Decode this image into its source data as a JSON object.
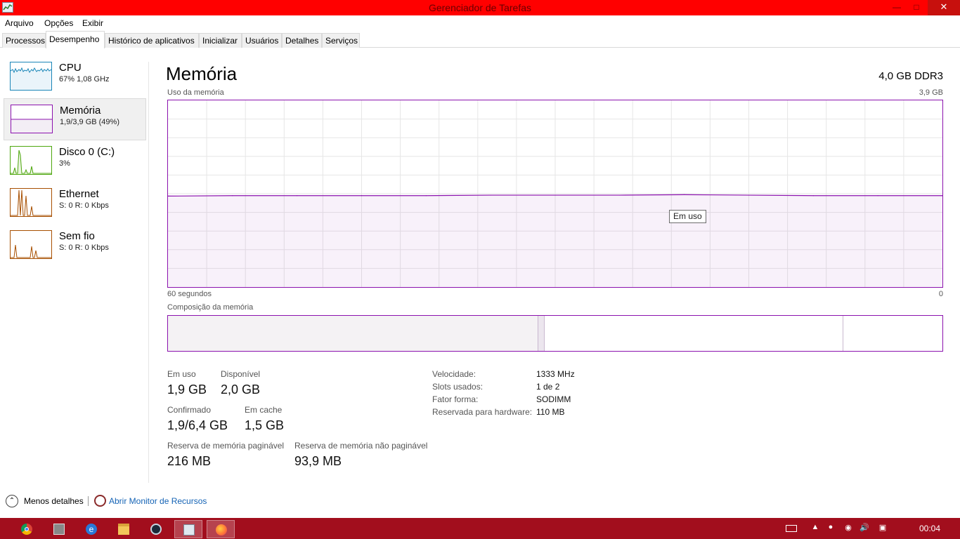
{
  "window": {
    "title": "Gerenciador de Tarefas",
    "controls": {
      "minimize": "—",
      "maximize": "□",
      "close": "✕"
    }
  },
  "menu": [
    "Arquivo",
    "Opções",
    "Exibir"
  ],
  "tabs": [
    "Processos",
    "Desempenho",
    "Histórico de aplicativos",
    "Inicializar",
    "Usuários",
    "Detalhes",
    "Serviços"
  ],
  "active_tab": "Desempenho",
  "sidebar": {
    "items": [
      {
        "name": "CPU",
        "detail": "67% 1,08 GHz",
        "color": "#1a86b8"
      },
      {
        "name": "Memória",
        "detail": "1,9/3,9 GB (49%)",
        "color": "#8b12ae",
        "selected": true
      },
      {
        "name": "Disco 0 (C:)",
        "detail": "3%",
        "color": "#4da60c"
      },
      {
        "name": "Ethernet",
        "detail": "S: 0 R: 0 Kbps",
        "color": "#a74f01"
      },
      {
        "name": "Sem fio",
        "detail": "S: 0 R: 0 Kbps",
        "color": "#a74f01"
      }
    ]
  },
  "main": {
    "title": "Memória",
    "spec": "4,0 GB DDR3",
    "usage_caption": "Uso da memória",
    "usage_max": "3,9 GB",
    "time_left": "60 segundos",
    "time_right": "0",
    "tooltip": "Em uso",
    "composition_caption": "Composição da memória",
    "stats": {
      "in_use_label": "Em uso",
      "in_use_value": "1,9 GB",
      "available_label": "Disponível",
      "available_value": "2,0 GB",
      "committed_label": "Confirmado",
      "committed_value": "1,9/6,4 GB",
      "cached_label": "Em cache",
      "cached_value": "1,5 GB",
      "paged_label": "Reserva de memória paginável",
      "paged_value": "216 MB",
      "nonpaged_label": "Reserva de memória não paginável",
      "nonpaged_value": "93,9 MB"
    },
    "info": {
      "speed_label": "Velocidade:",
      "speed_value": "1333 MHz",
      "slots_label": "Slots usados:",
      "slots_value": "1 de 2",
      "form_label": "Fator forma:",
      "form_value": "SODIMM",
      "reserved_label": "Reservada para hardware:",
      "reserved_value": "110 MB"
    }
  },
  "footer": {
    "less_details": "Menos detalhes",
    "resource_monitor": "Abrir Monitor de Recursos"
  },
  "taskbar": {
    "apps": [
      "chrome-icon",
      "calculator-icon",
      "internet-explorer-icon",
      "file-explorer-icon",
      "steam-icon",
      "task-manager-icon",
      "firefox-icon"
    ],
    "time": "00:04"
  },
  "chart_data": {
    "type": "area",
    "title": "Uso da memória",
    "xlabel": "",
    "ylabel": "",
    "x": [
      60,
      55,
      50,
      45,
      40,
      35,
      30,
      25,
      20,
      15,
      10,
      5,
      0
    ],
    "series": [
      {
        "values": [
          1.9,
          1.91,
          1.91,
          1.91,
          1.91,
          1.92,
          1.92,
          1.92,
          1.93,
          1.92,
          1.91,
          1.91,
          1.91
        ]
      }
    ],
    "ylim": [
      0,
      3.9
    ],
    "xlim": [
      60,
      0
    ],
    "grid": true,
    "color": "#8b12ae"
  }
}
